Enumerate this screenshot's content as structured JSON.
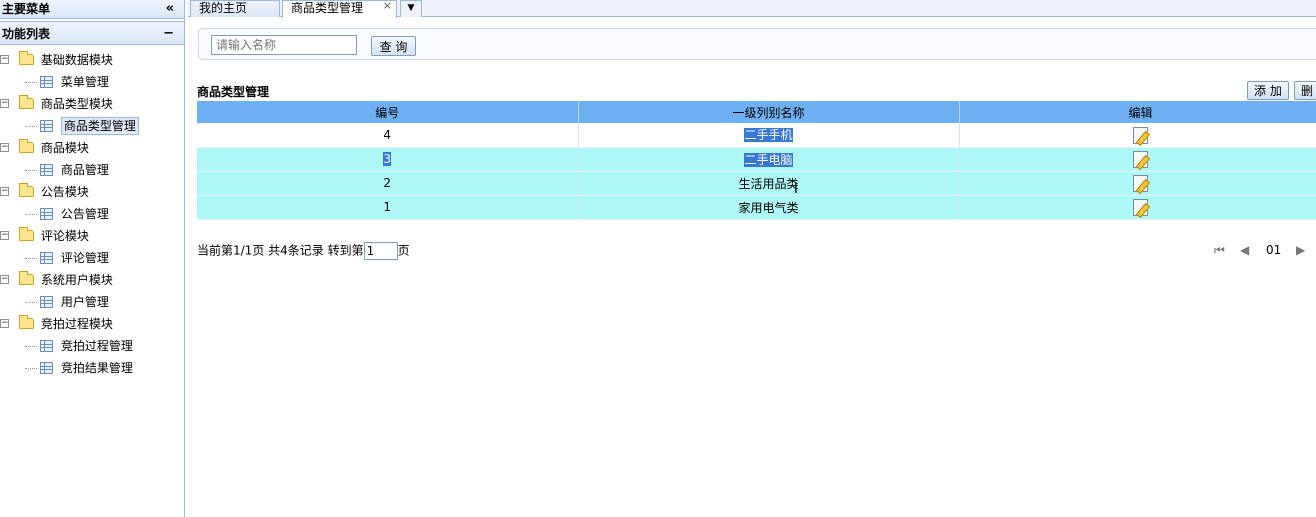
{
  "sidebar": {
    "header": "主要菜单",
    "collapse_glyph": "«",
    "section_title": "功能列表",
    "minus_glyph": "−",
    "tree": [
      {
        "label": "基础数据模块",
        "children": [
          "菜单管理"
        ]
      },
      {
        "label": "商品类型模块",
        "children": [
          "商品类型管理"
        ]
      },
      {
        "label": "商品模块",
        "children": [
          "商品管理"
        ]
      },
      {
        "label": "公告模块",
        "children": [
          "公告管理"
        ]
      },
      {
        "label": "评论模块",
        "children": [
          "评论管理"
        ]
      },
      {
        "label": "系统用户模块",
        "children": [
          "用户管理"
        ]
      },
      {
        "label": "竞拍过程模块",
        "children": [
          "竞拍过程管理",
          "竞拍结果管理"
        ]
      }
    ]
  },
  "tabs": [
    {
      "label": "我的主页"
    },
    {
      "label": "商品类型管理",
      "close": "×"
    }
  ],
  "search": {
    "placeholder": "请输入名称",
    "button": "查 询"
  },
  "grid": {
    "title": "商品类型管理",
    "add_button": "添 加",
    "delete_button": "删",
    "columns": [
      "编号",
      "一级列别名称",
      "编辑"
    ],
    "rows": [
      {
        "id": "4",
        "name": "二手手机"
      },
      {
        "id": "3",
        "name": "二手电脑"
      },
      {
        "id": "2",
        "name": "生活用品类"
      },
      {
        "id": "1",
        "name": "家用电气类"
      }
    ]
  },
  "pager": {
    "info": "当前第1/1页 共4条记录 转到第",
    "page_value": "1",
    "suffix": "页",
    "first": "⏮",
    "prev": "◀",
    "current": "01",
    "next": "▶"
  },
  "colors": {
    "header_blue": "#6fb0f4",
    "alt_row": "#aef8f8",
    "selection": "#3777d7"
  }
}
